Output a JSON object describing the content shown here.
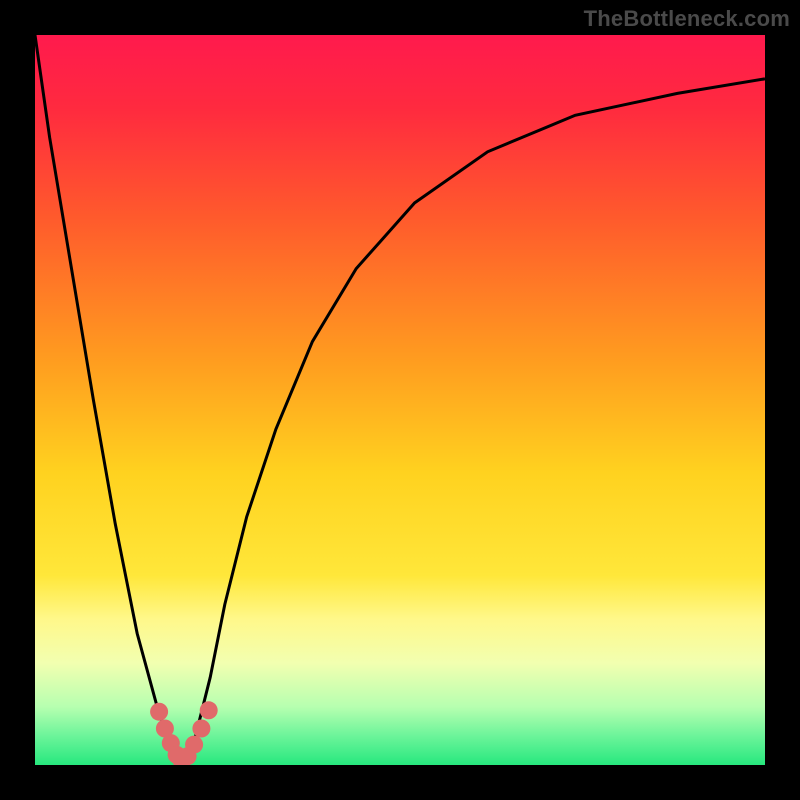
{
  "watermark": "TheBottleneck.com",
  "colors": {
    "frame": "#000000",
    "curve": "#000000",
    "sweet_spot_marker": "#e06a6a",
    "gradient_stops": [
      {
        "pct": 0,
        "color": "#ff1a4d"
      },
      {
        "pct": 10,
        "color": "#ff2a3f"
      },
      {
        "pct": 25,
        "color": "#ff5a2c"
      },
      {
        "pct": 45,
        "color": "#ff9e1f"
      },
      {
        "pct": 60,
        "color": "#ffd21f"
      },
      {
        "pct": 74,
        "color": "#ffe73a"
      },
      {
        "pct": 80,
        "color": "#fff88a"
      },
      {
        "pct": 86,
        "color": "#f2ffb0"
      },
      {
        "pct": 92,
        "color": "#b7ffb0"
      },
      {
        "pct": 96,
        "color": "#6cf49a"
      },
      {
        "pct": 100,
        "color": "#27e87e"
      }
    ]
  },
  "chart_data": {
    "type": "line",
    "title": "",
    "xlabel": "",
    "ylabel": "",
    "x": [
      0.0,
      0.02,
      0.05,
      0.08,
      0.11,
      0.14,
      0.17,
      0.19,
      0.2,
      0.21,
      0.22,
      0.24,
      0.26,
      0.29,
      0.33,
      0.38,
      0.44,
      0.52,
      0.62,
      0.74,
      0.88,
      1.0
    ],
    "values": [
      1.0,
      0.86,
      0.68,
      0.5,
      0.33,
      0.18,
      0.07,
      0.02,
      0.0,
      0.01,
      0.04,
      0.12,
      0.22,
      0.34,
      0.46,
      0.58,
      0.68,
      0.77,
      0.84,
      0.89,
      0.92,
      0.94
    ],
    "xlim": [
      0,
      1
    ],
    "ylim": [
      0,
      1
    ],
    "grid": false,
    "legend": false,
    "sweet_spot": {
      "x_range": [
        0.17,
        0.24
      ],
      "y_range": [
        0.0,
        0.08
      ]
    },
    "note": "x and y are normalized to the plotting area. The curve is a V-shaped bottleneck chart with minimum (0% bottleneck) near x≈0.20; the salmon dots mark the low-bottleneck sweet spot."
  }
}
